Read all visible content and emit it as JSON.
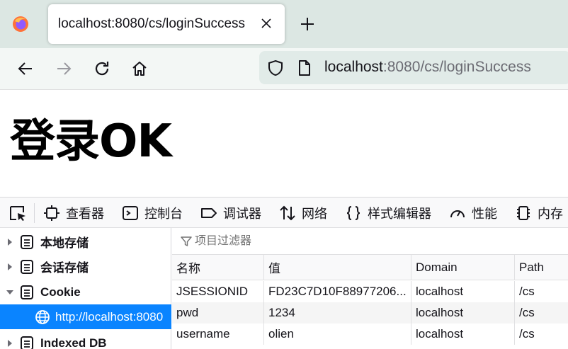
{
  "tab": {
    "title": "localhost:8080/cs/loginSuccess"
  },
  "url": {
    "host": "localhost",
    "rest": ":8080/cs/loginSuccess"
  },
  "page": {
    "heading": "登录OK"
  },
  "devtools": {
    "tools": [
      "查看器",
      "控制台",
      "调试器",
      "网络",
      "样式编辑器",
      "性能",
      "内存"
    ]
  },
  "storage": {
    "tree": [
      "本地存储",
      "会话存储",
      "Cookie",
      "http://localhost:8080",
      "Indexed DB"
    ]
  },
  "table": {
    "filter_placeholder": "项目过滤器",
    "columns": [
      "名称",
      "值",
      "Domain",
      "Path"
    ],
    "rows": [
      [
        "JSESSIONID",
        "FD23C7D10F88977206...",
        "localhost",
        "/cs"
      ],
      [
        "pwd",
        "1234",
        "localhost",
        "/cs"
      ],
      [
        "username",
        "olien",
        "localhost",
        "/cs"
      ]
    ]
  },
  "colors": {
    "selection": "#0a84ff",
    "tabstrip": "#dce7e3",
    "urlbar": "#e1ebe8"
  }
}
